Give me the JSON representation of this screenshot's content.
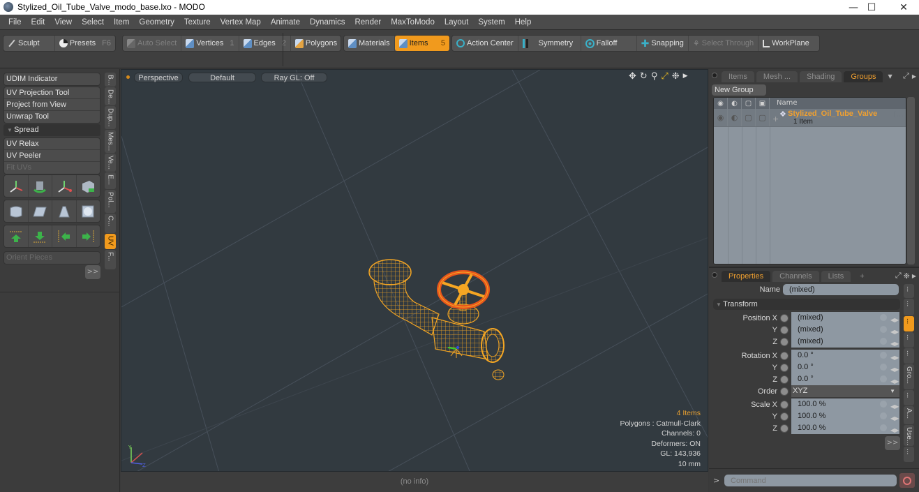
{
  "window": {
    "title": "Stylized_Oil_Tube_Valve_modo_base.lxo - MODO",
    "controls": [
      "minimize",
      "maximize",
      "close"
    ]
  },
  "menu": [
    "File",
    "Edit",
    "View",
    "Select",
    "Item",
    "Geometry",
    "Texture",
    "Vertex Map",
    "Animate",
    "Dynamics",
    "Render",
    "MaxToModo",
    "Layout",
    "System",
    "Help"
  ],
  "toolbar": {
    "sculpt": "Sculpt",
    "presets": "Presets",
    "presets_key": "F6",
    "auto_select": "Auto Select",
    "vertices": "Vertices",
    "vertices_key": "1",
    "edges": "Edges",
    "edges_key": "2",
    "polygons": "Polygons",
    "materials": "Materials",
    "items": "Items",
    "items_key": "5",
    "action_center": "Action Center",
    "symmetry": "Symmetry",
    "falloff": "Falloff",
    "snapping": "Snapping",
    "select_through": "Select Through",
    "workplane": "WorkPlane"
  },
  "left_panel": {
    "udim": "UDIM Indicator",
    "tools1": [
      "UV Projection Tool",
      "Project from View",
      "Unwrap Tool"
    ],
    "spread": "Spread",
    "tools2": [
      "UV Relax",
      "UV Peeler",
      "Fit UVs"
    ],
    "orient": "Orient Pieces",
    "more": ">>",
    "vtabs": [
      "B...",
      "De...",
      "Dup...",
      "Mes...",
      "Ve...",
      "E...",
      "Pol...",
      "C...",
      "UV",
      "F..."
    ],
    "active_vtab": "UV"
  },
  "viewport": {
    "view": "Perspective",
    "shading": "Default",
    "raygl": "Ray GL: Off",
    "stats": {
      "items": "4 Items",
      "polygons": "Polygons : Catmull-Clark",
      "channels": "Channels: 0",
      "deformers": "Deformers: ON",
      "gl": "GL: 143,936",
      "unit": "10 mm"
    },
    "status": "(no info)",
    "wire_color": "#f5a623"
  },
  "groups_panel": {
    "tabs": [
      "Items",
      "Mesh ...",
      "Shading",
      "Groups"
    ],
    "active_tab": "Groups",
    "new_group": "New Group",
    "col_name": "Name",
    "group": {
      "name": "Stylized_Oil_Tube_Valve",
      "suffix": "(...",
      "count": "1 Item"
    }
  },
  "properties_panel": {
    "tabs": [
      "Properties",
      "Channels",
      "Lists",
      "+"
    ],
    "active_tab": "Properties",
    "name_label": "Name",
    "name_value": "(mixed)",
    "section": "Transform",
    "rows": [
      {
        "label": "Position X",
        "value": "(mixed)"
      },
      {
        "label": "Y",
        "value": "(mixed)"
      },
      {
        "label": "Z",
        "value": "(mixed)"
      },
      {
        "label": "Rotation X",
        "value": "0.0 °"
      },
      {
        "label": "Y",
        "value": "0.0 °"
      },
      {
        "label": "Z",
        "value": "0.0 °"
      },
      {
        "label": "Order",
        "value": "XYZ"
      },
      {
        "label": "Scale X",
        "value": "100.0 %"
      },
      {
        "label": "Y",
        "value": "100.0 %"
      },
      {
        "label": "Z",
        "value": "100.0 %"
      }
    ],
    "more": ">>",
    "vtabs": [
      "...",
      "...",
      "...",
      "...",
      "...",
      "Gro...",
      "...",
      "A...",
      "Use...",
      "..."
    ]
  },
  "command": {
    "prompt": ">",
    "placeholder": "Command"
  },
  "colors": {
    "accent": "#f19a1d",
    "group_name": "#f0a030"
  }
}
